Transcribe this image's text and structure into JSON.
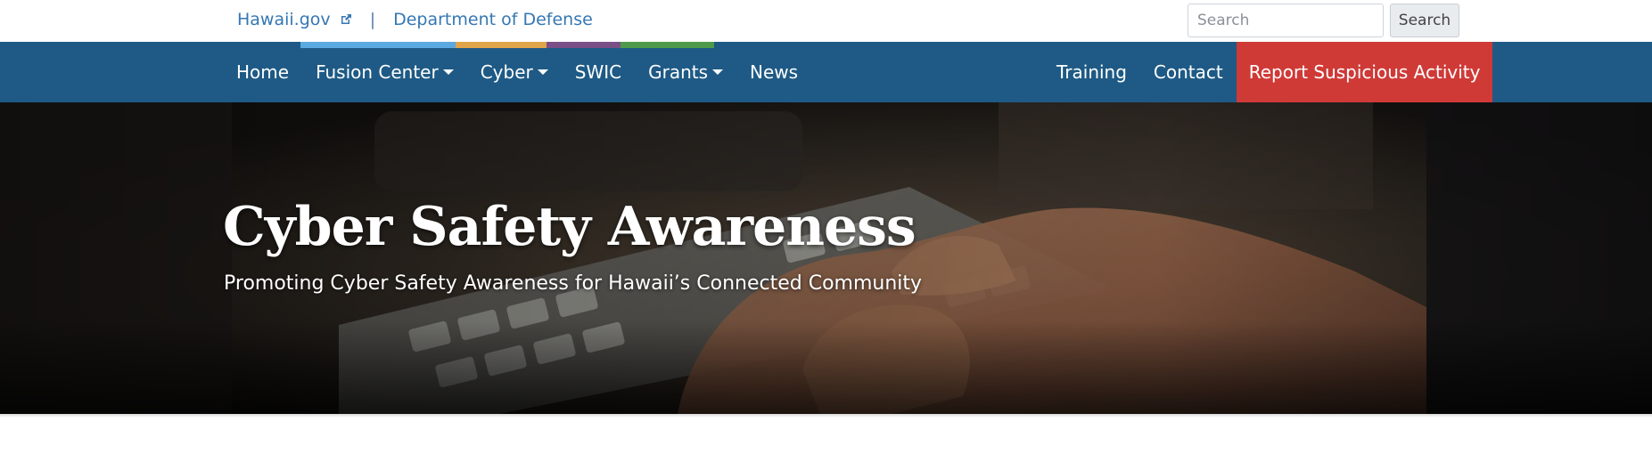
{
  "utility": {
    "hawaii_gov": "Hawaii.gov",
    "divider": "|",
    "department": "Department of Defense",
    "search_placeholder": "Search",
    "search_button": "Search"
  },
  "accent_colors": [
    "#5aa9e0",
    "#e0a54a",
    "#7a4f86",
    "#4e9a4a"
  ],
  "nav": {
    "left_items": [
      {
        "label": "Home"
      },
      {
        "label": "Fusion Center"
      },
      {
        "label": "Cyber"
      },
      {
        "label": "SWIC"
      },
      {
        "label": "Grants"
      },
      {
        "label": "News"
      }
    ],
    "right_items": [
      {
        "label": "Training"
      },
      {
        "label": "Contact"
      }
    ],
    "report_label": "Report Suspicious Activity",
    "colors": {
      "nav_bg": "#1e5a85",
      "report_bg": "#cf3a37"
    }
  },
  "hero": {
    "title": "Cyber Safety Awareness",
    "subtitle": "Promoting Cyber Safety Awareness for Hawaii’s Connected Community"
  }
}
